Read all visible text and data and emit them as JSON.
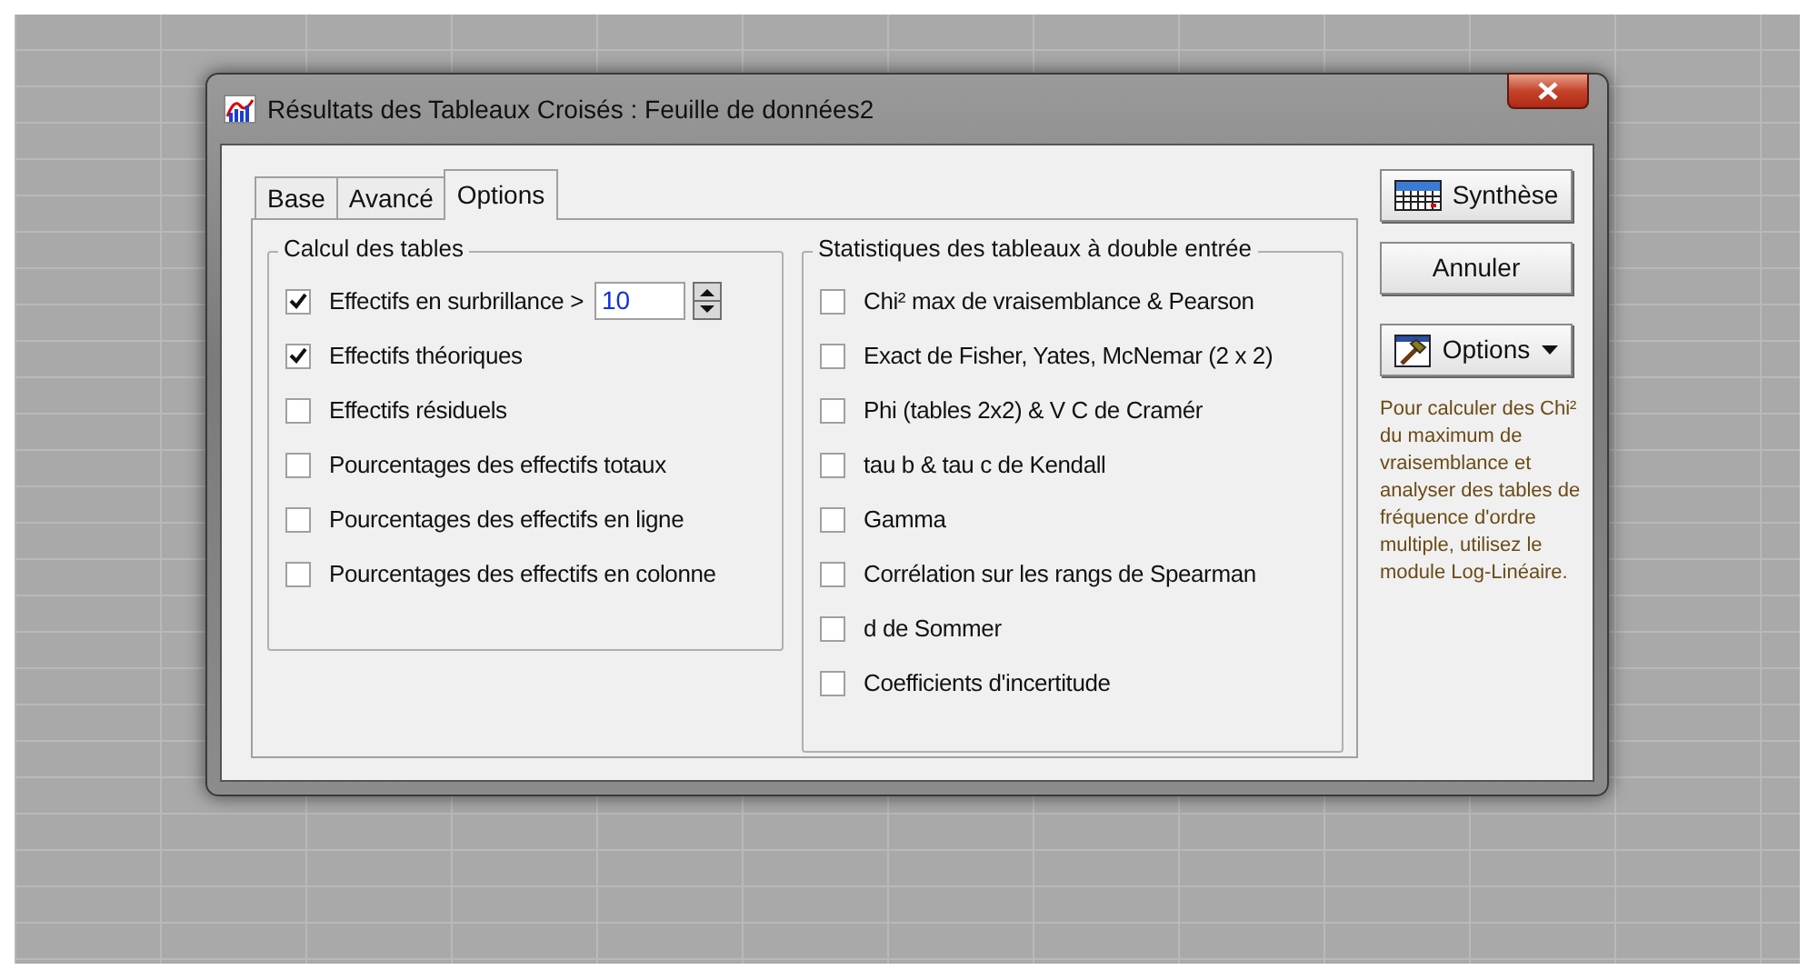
{
  "window": {
    "title": "Résultats des Tableaux Croisés : Feuille de données2"
  },
  "tabs": [
    {
      "label": "Base",
      "selected": false
    },
    {
      "label": "Avancé",
      "selected": false
    },
    {
      "label": "Options",
      "selected": true
    }
  ],
  "groups": [
    {
      "title": "Calcul des tables",
      "items": [
        {
          "kind": "spin",
          "label": "Effectifs en surbrillance >",
          "checked": true,
          "value": "10"
        },
        {
          "kind": "checkbox",
          "label": "Effectifs théoriques",
          "checked": true
        },
        {
          "kind": "checkbox",
          "label": "Effectifs résiduels",
          "checked": false
        },
        {
          "kind": "checkbox",
          "label": "Pourcentages des effectifs totaux",
          "checked": false
        },
        {
          "kind": "checkbox",
          "label": "Pourcentages des effectifs en ligne",
          "checked": false
        },
        {
          "kind": "checkbox",
          "label": "Pourcentages des effectifs en colonne",
          "checked": false
        }
      ]
    },
    {
      "title": "Statistiques des tableaux à double entrée",
      "items": [
        {
          "kind": "checkbox",
          "label": "Chi² max de vraisemblance & Pearson",
          "checked": false
        },
        {
          "kind": "checkbox",
          "label": "Exact de Fisher, Yates, McNemar (2 x 2)",
          "checked": false
        },
        {
          "kind": "checkbox",
          "label": "Phi (tables 2x2) & V  C de Cramér",
          "checked": false
        },
        {
          "kind": "checkbox",
          "label": "tau b & tau c de Kendall",
          "checked": false
        },
        {
          "kind": "checkbox",
          "label": "Gamma",
          "checked": false
        },
        {
          "kind": "checkbox",
          "label": "Corrélation sur les rangs de Spearman",
          "checked": false
        },
        {
          "kind": "checkbox",
          "label": "d de Sommer",
          "checked": false
        },
        {
          "kind": "checkbox",
          "label": "Coefficients d'incertitude",
          "checked": false
        }
      ]
    }
  ],
  "buttons": [
    {
      "kind": "summary",
      "label": "Synthèse"
    },
    {
      "kind": "plain",
      "label": "Annuler"
    },
    {
      "kind": "menu",
      "label": "Options"
    }
  ],
  "help_text": "Pour calculer des Chi² du maximum de vraisemblance et analyser des tables de fréquence d'ordre multiple, utilisez le module Log-Linéaire."
}
